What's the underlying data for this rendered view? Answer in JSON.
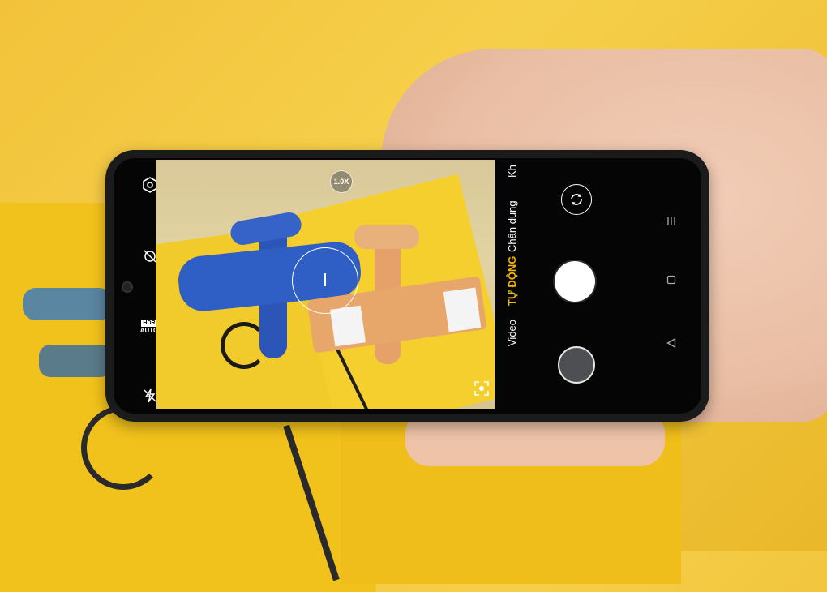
{
  "camera": {
    "zoom_label": "1.0X",
    "left_icons": {
      "settings": "settings-icon",
      "beauty_off": "beauty-off-icon",
      "hdr_line1": "HDR",
      "hdr_line2": "AUTO",
      "flash": "flash-off-icon"
    },
    "modes": [
      {
        "label": "Video",
        "active": false
      },
      {
        "label": "TỰ ĐỘNG",
        "active": true
      },
      {
        "label": "Chân dung",
        "active": false
      },
      {
        "label": "Kh",
        "active": false
      }
    ],
    "accent_color": "#f5b400"
  },
  "navbar": {
    "menu_icon": "menu-icon",
    "home_icon": "square-home-icon",
    "back_icon": "triangle-back-icon"
  }
}
